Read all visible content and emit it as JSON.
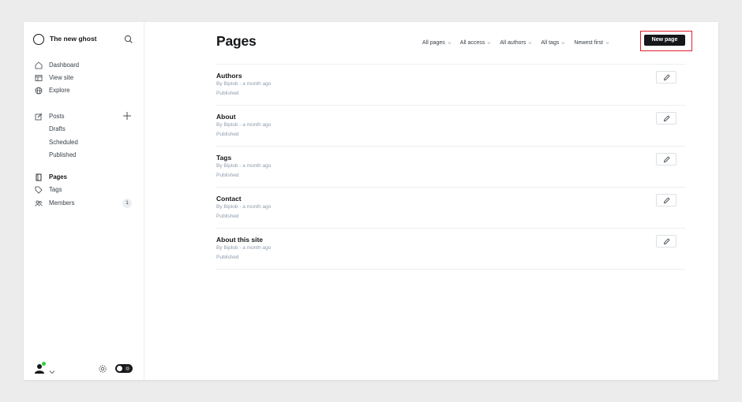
{
  "sidebar": {
    "site_title": "The new ghost",
    "nav": {
      "dashboard": "Dashboard",
      "view_site": "View site",
      "explore": "Explore",
      "posts": "Posts",
      "drafts": "Drafts",
      "scheduled": "Scheduled",
      "published": "Published",
      "pages": "Pages",
      "tags": "Tags",
      "members": "Members",
      "members_count": "1"
    }
  },
  "header": {
    "title": "Pages",
    "filters": [
      "All pages",
      "All access",
      "All authors",
      "All tags",
      "Newest first"
    ],
    "new_page_label": "New page"
  },
  "pages": [
    {
      "title": "Authors",
      "meta": "By Biplob - a month ago",
      "status": "Published"
    },
    {
      "title": "About",
      "meta": "By Biplob - a month ago",
      "status": "Published"
    },
    {
      "title": "Tags",
      "meta": "By Biplob - a month ago",
      "status": "Published"
    },
    {
      "title": "Contact",
      "meta": "By Biplob - a month ago",
      "status": "Published"
    },
    {
      "title": "About this site",
      "meta": "By Biplob - a month ago",
      "status": "Published"
    }
  ],
  "colors": {
    "accent_dark": "#15171a",
    "highlight_border": "#e0202d",
    "online_indicator": "#30cf43",
    "muted_text": "#8e9cac"
  },
  "icons": {
    "logo": "ghost-logo-icon",
    "search": "search-icon",
    "dashboard": "home-icon",
    "view_site": "browser-icon",
    "explore": "globe-icon",
    "posts": "pencil-square-icon",
    "add": "plus-icon",
    "pages": "page-icon",
    "tags": "tag-icon",
    "members": "members-icon",
    "edit": "pencil-icon",
    "settings": "gear-icon",
    "theme_toggle": "dark-mode-toggle-icon"
  }
}
